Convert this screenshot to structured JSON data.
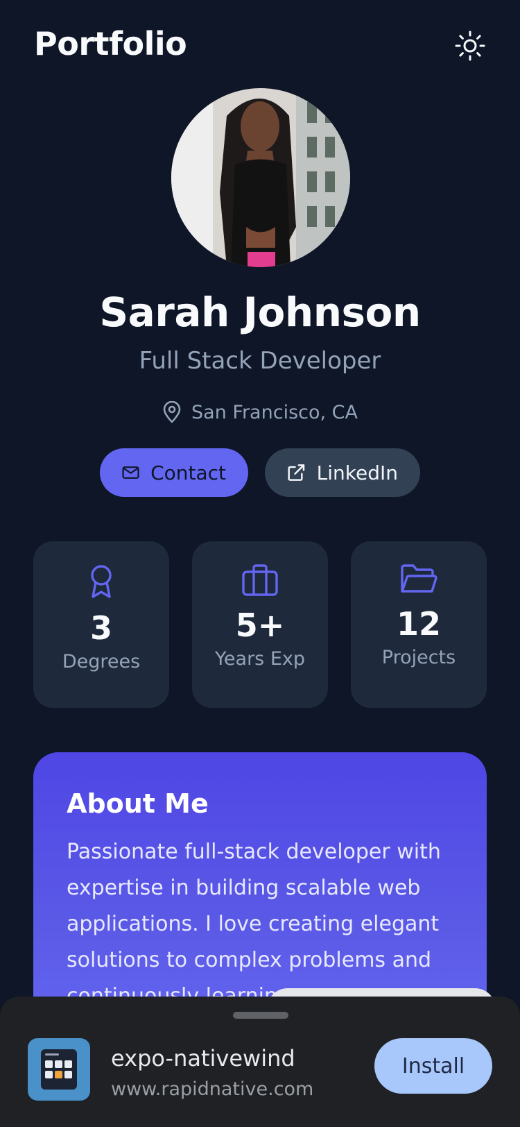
{
  "header": {
    "title": "Portfolio",
    "theme_icon": "sun-icon"
  },
  "profile": {
    "name": "Sarah Johnson",
    "role": "Full Stack Developer",
    "location": "San Francisco, CA"
  },
  "actions": {
    "contact_label": "Contact",
    "linkedin_label": "LinkedIn"
  },
  "stats": [
    {
      "icon": "award-icon",
      "value": "3",
      "label": "Degrees"
    },
    {
      "icon": "briefcase-icon",
      "value": "5+",
      "label": "Years Exp"
    },
    {
      "icon": "folder-icon",
      "value": "12",
      "label": "Projects"
    }
  ],
  "about": {
    "title": "About Me",
    "text": "Passionate full-stack developer with expertise in building scalable web applications. I love creating elegant solutions to complex problems and continuously learnin"
  },
  "install_prompt": {
    "app_name": "expo-nativewind",
    "url": "www.rapidnative.com",
    "button_label": "Install"
  },
  "colors": {
    "background": "#0e1628",
    "card": "#1e293b",
    "accent": "#6366f1",
    "muted_text": "#94a3b8"
  }
}
